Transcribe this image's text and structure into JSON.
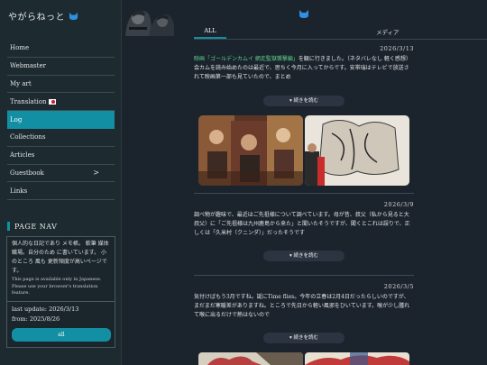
{
  "site": {
    "title": "やがらねっと"
  },
  "nav": {
    "items": [
      {
        "label": "Home"
      },
      {
        "label": "Webmaster"
      },
      {
        "label": "My art"
      },
      {
        "label": "Translation"
      },
      {
        "label": "Log"
      },
      {
        "label": "Collections"
      },
      {
        "label": "Articles"
      },
      {
        "label": "Guestbook"
      },
      {
        "label": "Links"
      }
    ],
    "guestbook_arrow": ">"
  },
  "page_nav": {
    "title": "PAGE NAV",
    "description": "個人的な日記であり メモ帳。 軟筆 媒体 職場。自分のため に書いています。 小のところ 風も 更新頻度が高いページです。",
    "english_note": "This page is available only in Japanese. Please use your browser's translation feature.",
    "last_update": "last update: 2026/3/13",
    "from": "from: 2025/8/26",
    "all_button": "all"
  },
  "tabs": {
    "all": "ALL",
    "media": "メディア"
  },
  "posts": [
    {
      "date": "2026/3/13",
      "highlight": "映画「ゴールデンカムイ 網走監獄襲撃編」",
      "body": "を観に行きました。（ネタバレなし 軽く感想）会カムを読み始めたのは最近で、思ちく今月に入ってからです。安帯瑞はテレビで放送されて映画第一部も見ていたので、まとめ",
      "more": "続きを読む"
    },
    {
      "date": "2026/3/9",
      "body": "調べ物が趣味で、最近はご先祖様について調べています。母が昔、叔父（私から見ると大叔父）に「ご先祖様は九州鹿島から来た」と聞いたそうですが、聞くとこれは誤りで、正しくは「久米村（クニンダ）」だったそうです",
      "more": "続きを読む"
    },
    {
      "date": "2026/3/5",
      "body": "気付けばもう3月ですね。誕にTime flies。今年の立春は2月4日だったらしいのですが、まだまだ寒暖差がありますね。ところで先日から軽い風邪をひいています。喉が少し腫れて喉に出るだけで熱はないので",
      "more": "続きを読む"
    }
  ],
  "colors": {
    "accent": "#128fa3",
    "highlight": "#5fd08c",
    "logo": "#2f8fe0",
    "background": "#1b232d",
    "sidebar": "#1d2b31"
  },
  "icons": {
    "logo": "blue-cat-head-icon",
    "flag": "japan-flag-icon",
    "more": "down-triangle-icon"
  }
}
